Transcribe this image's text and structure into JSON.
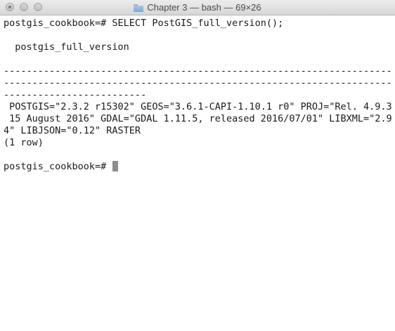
{
  "window": {
    "title": "Chapter 3 — bash — 69×26"
  },
  "terminal": {
    "lines": [
      "postgis_cookbook=# SELECT PostGIS_full_version();",
      "",
      "  postgis_full_version",
      "",
      "---------------------------------------------------------------------",
      "---------------------------------------------------------------------",
      "-------------------------",
      " POSTGIS=\"2.3.2 r15302\" GEOS=\"3.6.1-CAPI-1.10.1 r0\" PROJ=\"Rel. 4.9.3,",
      " 15 August 2016\" GDAL=\"GDAL 1.11.5, released 2016/07/01\" LIBXML=\"2.9.",
      "4\" LIBJSON=\"0.12\" RASTER",
      "(1 row)",
      ""
    ],
    "prompt": "postgis_cookbook=# "
  }
}
